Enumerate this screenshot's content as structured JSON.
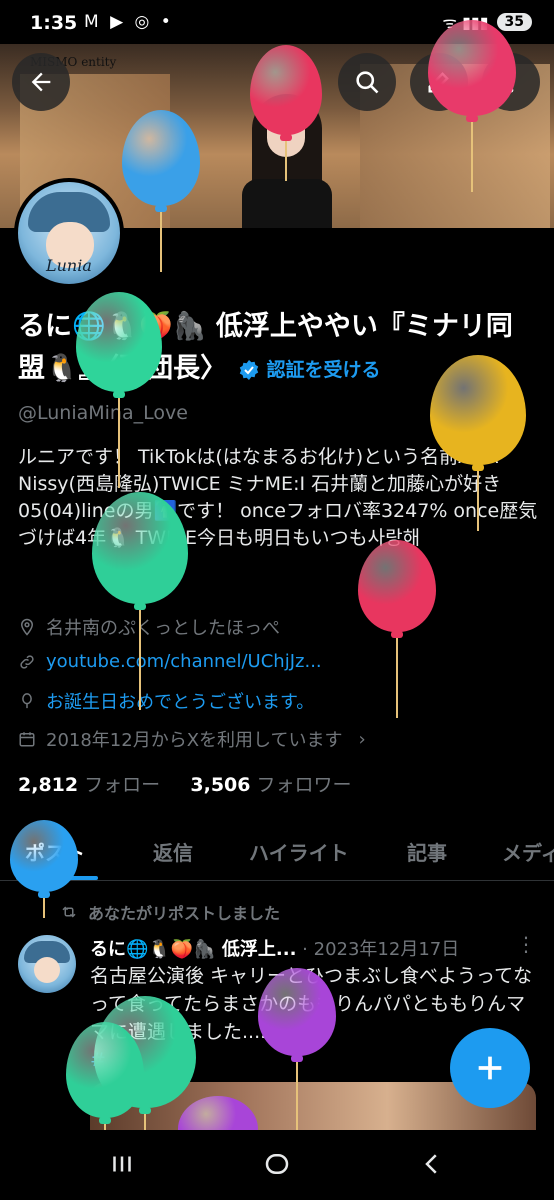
{
  "status_bar": {
    "time": "1:35",
    "notifications": "M ▶ ◎ •",
    "signal": "ᯤ ▮▮▮",
    "battery": "35"
  },
  "header": {
    "back_icon": "arrow-left-icon",
    "banner_brand": "MISMO entity"
  },
  "profile": {
    "name_line": "るに🌐🐧🍑🦍 低浮上ややい『ミナリ同盟🐧』〈副団長〉",
    "verify_label": "認証を受ける",
    "handle": "@LuniaMina_Love",
    "bio": "ルニアです！ TikTokは(はなまるお化け)という名前AAA Nissy(西島隆弘)TWICE ミナME:I 石井蘭と加藤心が好き 05(04)lineの男🚹です！ onceフォロバ率3247% once歴気づけば4年🐧 TWICE今日も明日もいつも사랑해",
    "location": "名井南のぷくっとしたほっぺ",
    "link": "youtube.com/channel/UChjJz...",
    "birthday": "お誕生日おめでとうございます。",
    "joined": "2018年12月からXを利用しています",
    "following_count": "2,812",
    "following_label": "フォロー",
    "followers_count": "3,506",
    "followers_label": "フォロワー"
  },
  "tabs": [
    {
      "label": "ポスト",
      "active": true
    },
    {
      "label": "返信",
      "active": false
    },
    {
      "label": "ハイライト",
      "active": false
    },
    {
      "label": "記事",
      "active": false
    },
    {
      "label": "メディア",
      "active": false
    }
  ],
  "post": {
    "repost_text": "あなたがリポストしました",
    "author": "るに🌐🐧🍑🦍 低浮上...",
    "date": "· 2023年12月17日",
    "text": "名古屋公演後 キャリーとひつまぶし食べようってなって食ってたらまさかのももりんパパとももりんママに遭遇しました......",
    "hashtag": "#"
  },
  "colors": {
    "accent": "#1d9bf0",
    "background": "#000000",
    "muted": "#71767b"
  }
}
